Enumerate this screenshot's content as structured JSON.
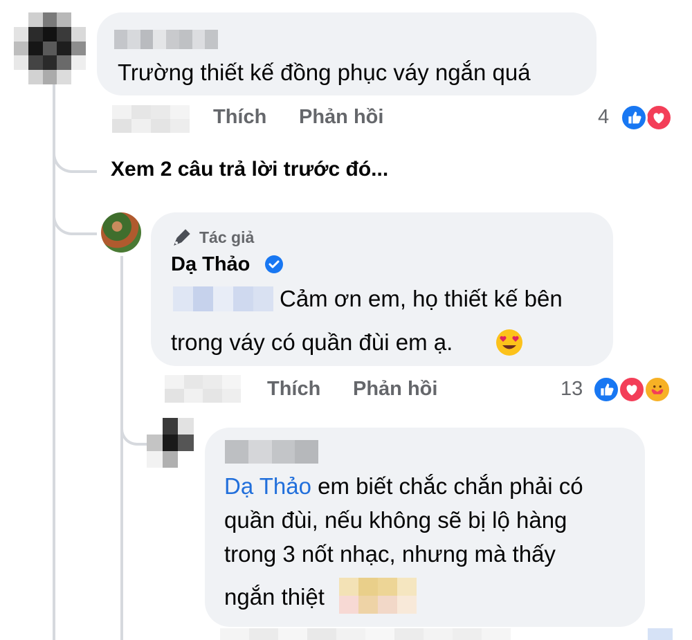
{
  "comment1": {
    "text": "Trường thiết kế đồng phục váy ngắn quá",
    "like_label": "Thích",
    "reply_label": "Phản hồi",
    "reaction_count": "4"
  },
  "view_previous_replies": "Xem 2 câu trả lời trước đó...",
  "reply1": {
    "badge": "Tác giả",
    "author": "Dạ Thảo",
    "text_line1": "Cảm ơn em, họ thiết kế bên",
    "text_line2": "trong váy có quần đùi em ạ.",
    "like_label": "Thích",
    "reply_label": "Phản hồi",
    "reaction_count": "13"
  },
  "reply2": {
    "mention": "Dạ Thảo",
    "text_line1": " em biết chắc chắn phải có",
    "text_line2": "quần đùi, nếu không sẽ bị lộ hàng",
    "text_line3": "trong 3 nốt nhạc, nhưng mà thấy",
    "text_line4": "ngắn thiệt"
  },
  "colors": {
    "bubble": "#f0f2f5",
    "secondary_text": "#65676b",
    "mention": "#216fdb",
    "like": "#1877f2",
    "love": "#f33e58",
    "verified": "#1877f2"
  }
}
